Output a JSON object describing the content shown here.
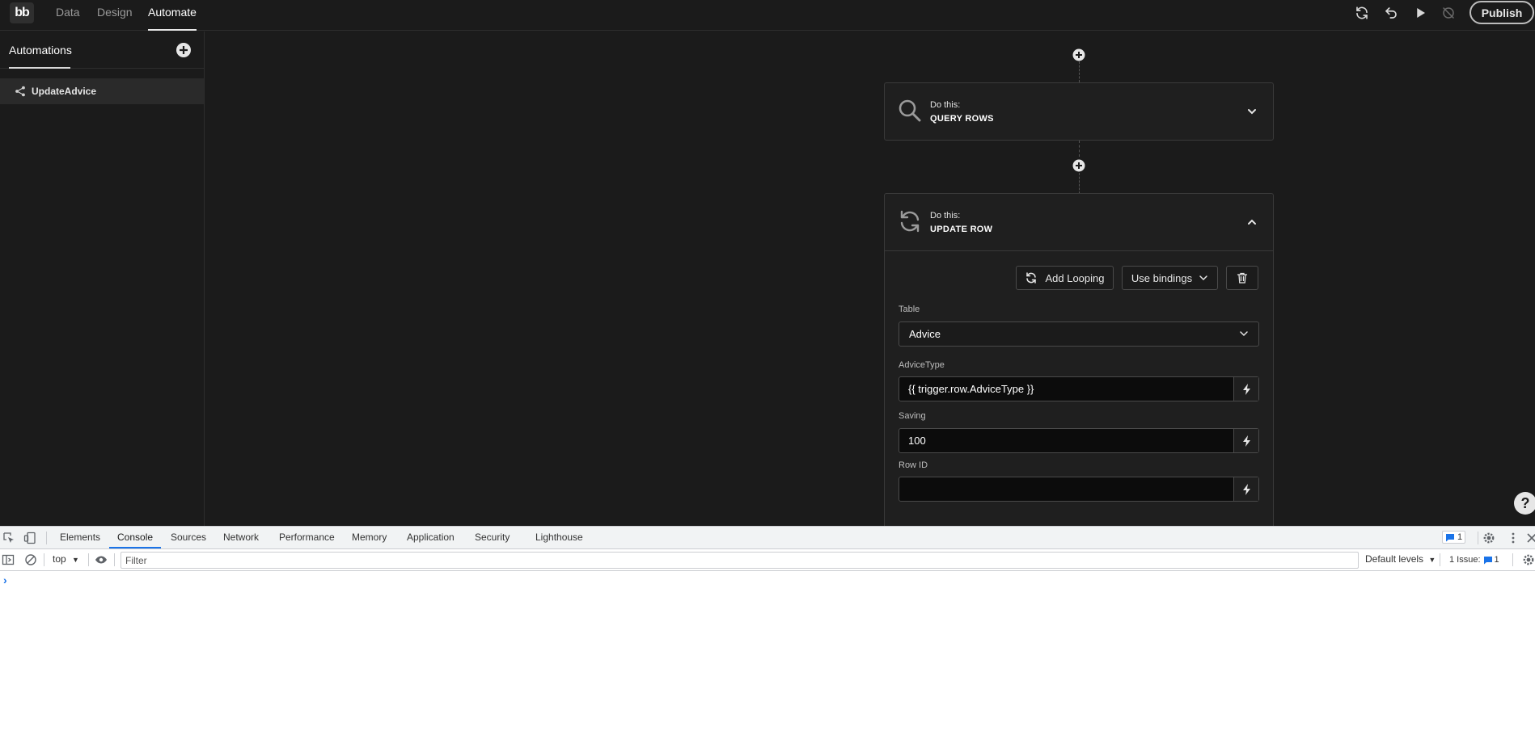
{
  "app": {
    "logo_text": "bb",
    "nav_tabs": [
      {
        "label": "Data"
      },
      {
        "label": "Design"
      },
      {
        "label": "Automate",
        "active": true
      }
    ],
    "publish_label": "Publish"
  },
  "sidebar": {
    "title": "Automations",
    "items": [
      {
        "label": "UpdateAdvice",
        "icon": "share-icon"
      }
    ]
  },
  "steps": [
    {
      "kicker": "Do this:",
      "name": "QUERY ROWS",
      "icon": "search-icon",
      "expanded": false
    },
    {
      "kicker": "Do this:",
      "name": "UPDATE ROW",
      "icon": "refresh-icon",
      "expanded": true
    }
  ],
  "update_row": {
    "add_looping_label": "Add Looping",
    "use_bindings_label": "Use bindings",
    "table_label": "Table",
    "table_value": "Advice",
    "fields": [
      {
        "label": "AdviceType",
        "value": "{{ trigger.row.AdviceType }}"
      },
      {
        "label": "Saving",
        "value": "100"
      },
      {
        "label": "Row ID",
        "value": ""
      }
    ]
  },
  "help_label": "?",
  "devtools": {
    "tabs": [
      "Elements",
      "Console",
      "Sources",
      "Network",
      "Performance",
      "Memory",
      "Application",
      "Security",
      "Lighthouse"
    ],
    "active_tab": "Console",
    "messages_count": "1",
    "context": "top",
    "filter_placeholder": "Filter",
    "levels_label": "Default levels",
    "issues_label": "1 Issue:",
    "issues_count": "1",
    "prompt": "›"
  },
  "colors": {
    "app_bg": "#1b1b1b",
    "card_bg": "#1f1f1f",
    "devtools_accent": "#1a73e8"
  }
}
